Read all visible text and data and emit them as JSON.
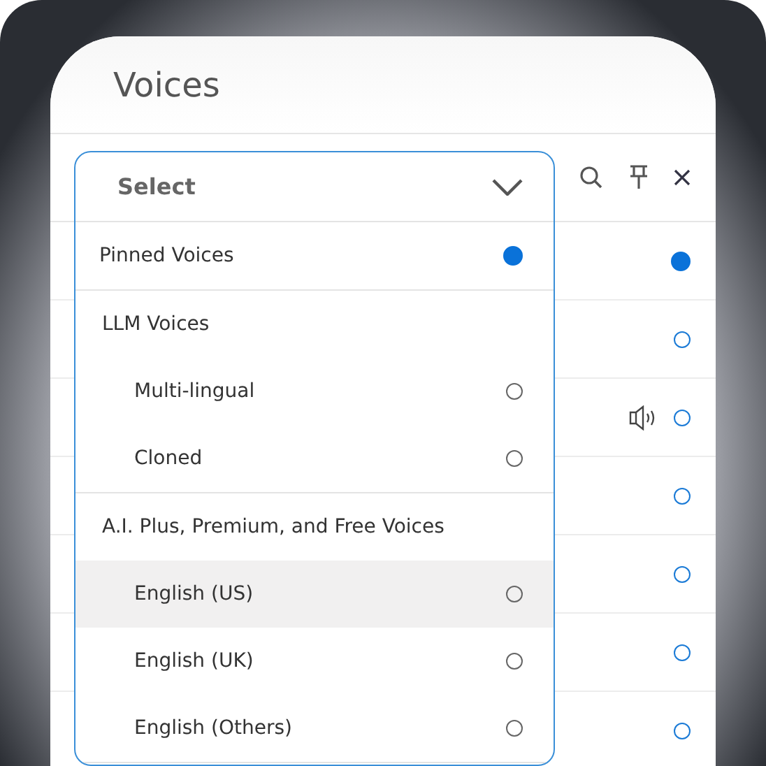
{
  "window": {
    "title": "Voices"
  },
  "rows": [
    {
      "kind": "plain",
      "selected": true
    },
    {
      "kind": "plain",
      "selected": false
    },
    {
      "kind": "preview",
      "selected": false
    },
    {
      "kind": "plain",
      "selected": false
    },
    {
      "kind": "plain",
      "selected": false
    },
    {
      "kind": "plain",
      "selected": false
    },
    {
      "kind": "plain",
      "selected": false
    }
  ],
  "dropdown": {
    "placeholder": "Select",
    "items": [
      {
        "kind": "option",
        "label": "Pinned Voices",
        "selected": true,
        "highlighted": false
      },
      {
        "kind": "group",
        "label": "LLM Voices",
        "children": [
          {
            "label": "Multi-lingual",
            "selected": false,
            "highlighted": false
          },
          {
            "label": "Cloned",
            "selected": false,
            "highlighted": false
          }
        ]
      },
      {
        "kind": "group",
        "label": "A.I. Plus, Premium, and Free Voices",
        "children": [
          {
            "label": "English (US)",
            "selected": false,
            "highlighted": true
          },
          {
            "label": "English (UK)",
            "selected": false,
            "highlighted": false
          },
          {
            "label": "English (Others)",
            "selected": false,
            "highlighted": false
          }
        ]
      }
    ]
  }
}
